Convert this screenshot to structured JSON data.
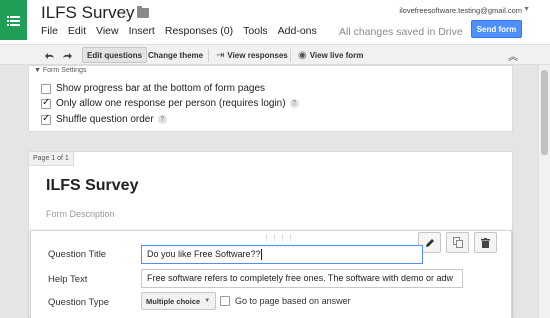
{
  "app": {
    "doc_title": "ILFS Survey",
    "account_email": "ilovefreesoftware.testing@gmail.com",
    "save_status": "All changes saved in Drive",
    "send_label": "Send form"
  },
  "menu": [
    "File",
    "Edit",
    "View",
    "Insert",
    "Responses (0)",
    "Tools",
    "Add-ons"
  ],
  "toolbar": {
    "edit_questions": "Edit questions",
    "change_theme": "Change theme",
    "view_responses": "View responses",
    "view_live_form": "View live form"
  },
  "settings": {
    "header": "Form Settings",
    "options": [
      {
        "label": "Show progress bar at the bottom of form pages",
        "checked": false,
        "help": false
      },
      {
        "label": "Only allow one response per person (requires login)",
        "checked": true,
        "help": true
      },
      {
        "label": "Shuffle question order",
        "checked": true,
        "help": true
      }
    ]
  },
  "page": {
    "label": "Page 1 of 1",
    "form_title": "ILFS Survey",
    "form_description_placeholder": "Form Description"
  },
  "question": {
    "title_label": "Question Title",
    "title_value": "Do you like Free Software??",
    "help_label": "Help Text",
    "help_value": "Free software refers to completely free ones. The software with demo or adw",
    "type_label": "Question Type",
    "type_value": "Multiple choice",
    "goto_label": "Go to page based on answer"
  },
  "colors": {
    "brand": "#1e9e57",
    "send_button": "#4d90fe"
  }
}
